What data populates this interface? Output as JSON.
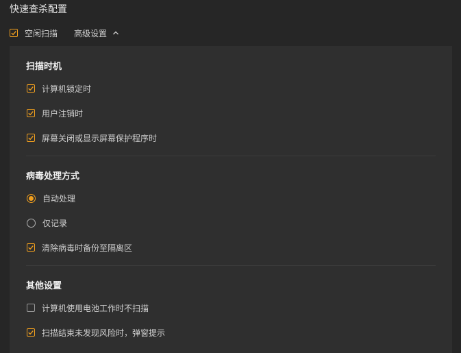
{
  "page_title": "快速查杀配置",
  "idle_scan": {
    "label": "空闲扫描",
    "checked": true
  },
  "advanced": {
    "label": "高级设置",
    "icon": "chevron-up-icon",
    "expanded": true
  },
  "accent_color": "#f2a01e",
  "sections": [
    {
      "title": "扫描时机",
      "options": [
        {
          "type": "checkbox",
          "label": "计算机锁定时",
          "checked": true
        },
        {
          "type": "checkbox",
          "label": "用户注销时",
          "checked": true
        },
        {
          "type": "checkbox",
          "label": "屏幕关闭或显示屏幕保护程序时",
          "checked": true
        }
      ]
    },
    {
      "title": "病毒处理方式",
      "options": [
        {
          "type": "radio",
          "label": "自动处理",
          "checked": true
        },
        {
          "type": "radio",
          "label": "仅记录",
          "checked": false
        },
        {
          "type": "checkbox",
          "label": "清除病毒时备份至隔离区",
          "checked": true
        }
      ]
    },
    {
      "title": "其他设置",
      "options": [
        {
          "type": "checkbox",
          "label": "计算机使用电池工作时不扫描",
          "checked": false
        },
        {
          "type": "checkbox",
          "label": "扫描结束未发现风险时，弹窗提示",
          "checked": true
        }
      ]
    }
  ]
}
